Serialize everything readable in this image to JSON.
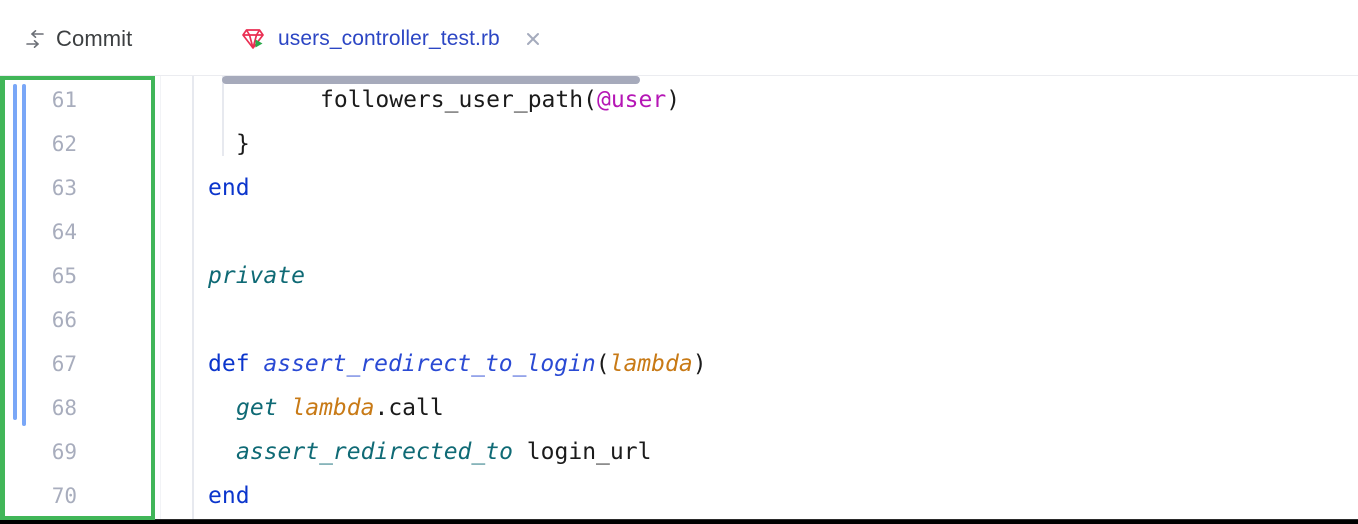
{
  "header": {
    "commit": {
      "label": "Commit",
      "icon": "commit-arrows-icon"
    },
    "tab": {
      "title": "users_controller_test.rb",
      "file_icon": "ruby-gem-run-icon",
      "close_icon": "close-icon"
    }
  },
  "editor": {
    "highlight_color": "#41b658",
    "fold_marker_color": "#7aa7f7",
    "scrollbar_color": "#a6aabb",
    "line_numbers": [
      "61",
      "62",
      "63",
      "64",
      "65",
      "66",
      "67",
      "68",
      "69",
      "70"
    ],
    "lines": [
      {
        "number": "61",
        "indent": 10,
        "tokens": [
          {
            "text": "followers_user_path",
            "kind": "plain"
          },
          {
            "text": "(",
            "kind": "plain"
          },
          {
            "text": "@user",
            "kind": "ivar"
          },
          {
            "text": ")",
            "kind": "plain"
          }
        ]
      },
      {
        "number": "62",
        "indent": 4,
        "tokens": [
          {
            "text": "}",
            "kind": "plain"
          }
        ]
      },
      {
        "number": "63",
        "indent": 2,
        "tokens": [
          {
            "text": "end",
            "kind": "kw"
          }
        ]
      },
      {
        "number": "64",
        "indent": 0,
        "tokens": []
      },
      {
        "number": "65",
        "indent": 2,
        "tokens": [
          {
            "text": "private",
            "kind": "ident"
          }
        ]
      },
      {
        "number": "66",
        "indent": 0,
        "tokens": []
      },
      {
        "number": "67",
        "indent": 2,
        "tokens": [
          {
            "text": "def ",
            "kind": "kw"
          },
          {
            "text": "assert_redirect_to_login",
            "kind": "method"
          },
          {
            "text": "(",
            "kind": "plain"
          },
          {
            "text": "lambda",
            "kind": "param"
          },
          {
            "text": ")",
            "kind": "plain"
          }
        ]
      },
      {
        "number": "68",
        "indent": 4,
        "tokens": [
          {
            "text": "get ",
            "kind": "ident"
          },
          {
            "text": "lambda",
            "kind": "param"
          },
          {
            "text": ".call",
            "kind": "plain"
          }
        ]
      },
      {
        "number": "69",
        "indent": 4,
        "tokens": [
          {
            "text": "assert_redirected_to",
            "kind": "ident"
          },
          {
            "text": " login_url",
            "kind": "plain"
          }
        ]
      },
      {
        "number": "70",
        "indent": 2,
        "tokens": [
          {
            "text": "end",
            "kind": "kw"
          }
        ]
      }
    ]
  }
}
